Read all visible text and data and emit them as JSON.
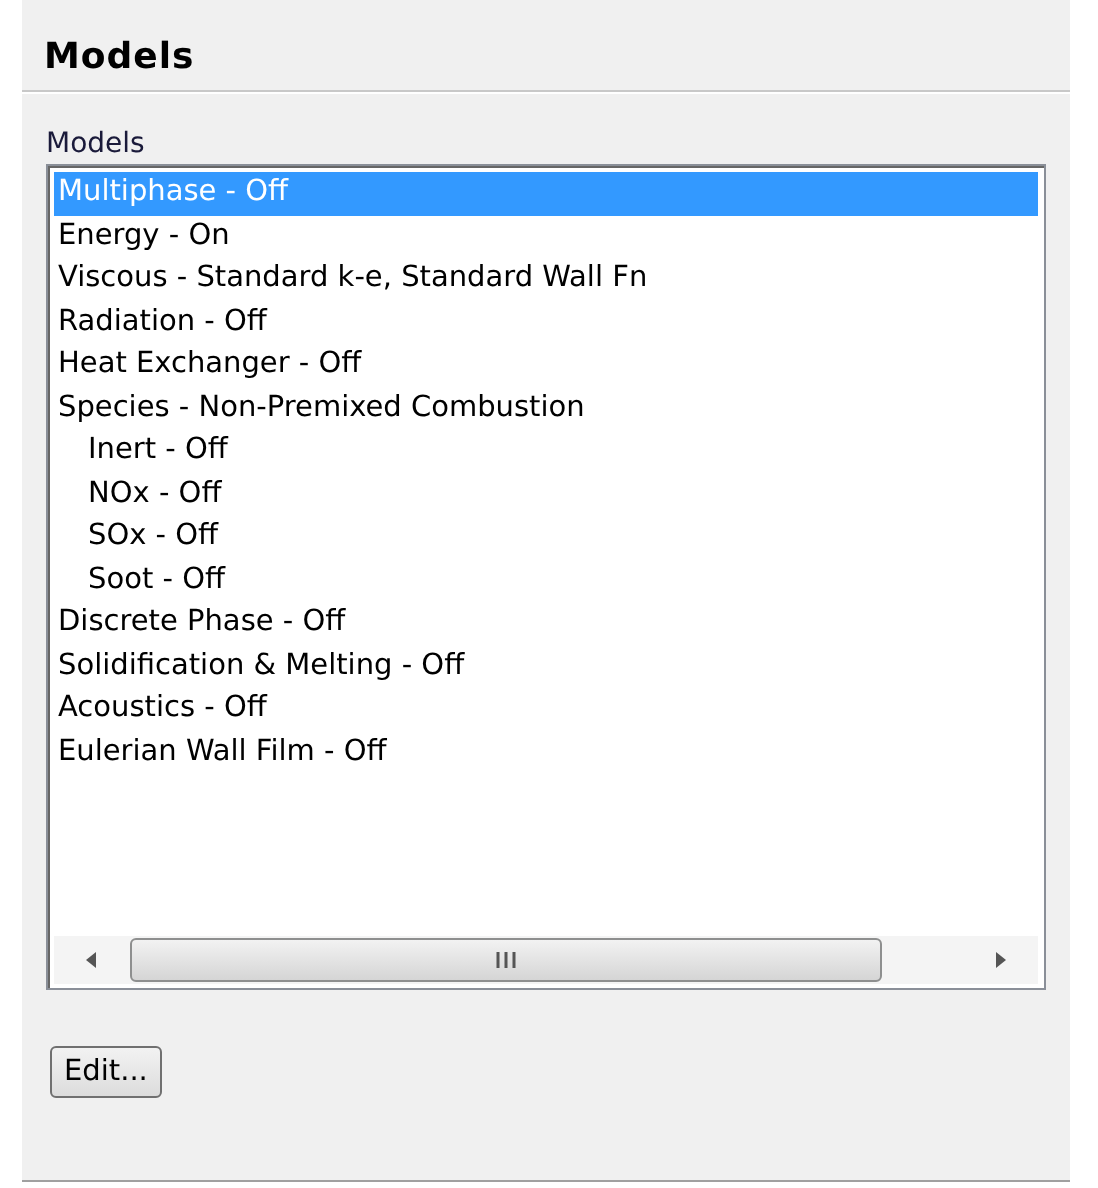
{
  "panel": {
    "title": "Models"
  },
  "models_list": {
    "label": "Models",
    "items": [
      {
        "label": "Multiphase - Off",
        "selected": true
      },
      {
        "label": "Energy - On",
        "selected": false
      },
      {
        "label": "Viscous - Standard k-e, Standard Wall Fn",
        "selected": false
      },
      {
        "label": "Radiation - Off",
        "selected": false
      },
      {
        "label": "Heat Exchanger - Off",
        "selected": false
      },
      {
        "label": "Species - Non-Premixed Combustion",
        "selected": false,
        "children": [
          {
            "label": "Inert - Off",
            "selected": false
          },
          {
            "label": "NOx - Off",
            "selected": false
          },
          {
            "label": "SOx - Off",
            "selected": false
          },
          {
            "label": "Soot - Off",
            "selected": false
          }
        ]
      },
      {
        "label": "Discrete Phase - Off",
        "selected": false
      },
      {
        "label": "Solidification & Melting - Off",
        "selected": false
      },
      {
        "label": "Acoustics - Off",
        "selected": false
      },
      {
        "label": "Eulerian Wall Film - Off",
        "selected": false
      }
    ]
  },
  "buttons": [
    {
      "label": "Edit..."
    }
  ]
}
